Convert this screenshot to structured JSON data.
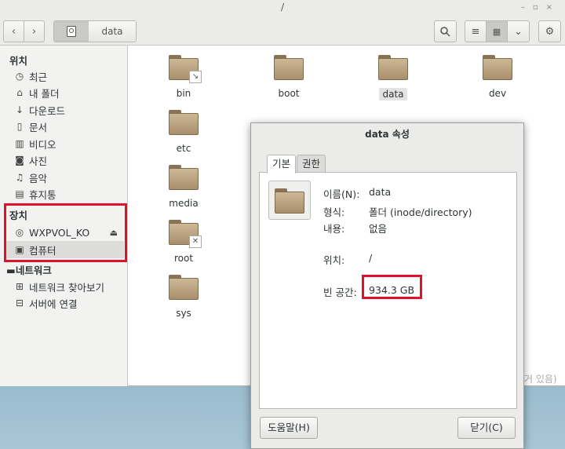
{
  "window": {
    "title": "/",
    "path_current": "data"
  },
  "sidebar": {
    "places_header": "위치",
    "places": [
      {
        "label": "최근",
        "icon": "clock-icon"
      },
      {
        "label": "내 폴더",
        "icon": "home-icon"
      },
      {
        "label": "다운로드",
        "icon": "download-icon"
      },
      {
        "label": "문서",
        "icon": "document-icon"
      },
      {
        "label": "비디오",
        "icon": "video-icon"
      },
      {
        "label": "사진",
        "icon": "camera-icon"
      },
      {
        "label": "음악",
        "icon": "music-icon"
      },
      {
        "label": "휴지통",
        "icon": "trash-icon"
      }
    ],
    "devices_header": "장치",
    "devices": [
      {
        "label": "WXPVOL_KO",
        "icon": "disc-icon"
      },
      {
        "label": "컴퓨터",
        "icon": "computer-icon"
      }
    ],
    "network_header": "네트워크",
    "network": [
      {
        "label": "네트워크 찾아보기",
        "icon": "network-icon"
      },
      {
        "label": "서버에 연결",
        "icon": "server-icon"
      }
    ]
  },
  "files": [
    {
      "name": "bin"
    },
    {
      "name": "boot"
    },
    {
      "name": "data"
    },
    {
      "name": "dev"
    },
    {
      "name": "etc"
    },
    {
      "name": "media"
    },
    {
      "name": "root"
    },
    {
      "name": "sys"
    }
  ],
  "status_fragment": "거 있음)",
  "dialog": {
    "title": "data 속성",
    "tabs": [
      "기본",
      "권한"
    ],
    "name_label": "이름(N):",
    "name_value": "data",
    "type_label": "형식:",
    "type_value": "폴더 (inode/directory)",
    "contents_label": "내용:",
    "contents_value": "없음",
    "location_label": "위치:",
    "location_value": "/",
    "free_label": "빈 공간:",
    "free_value": "934.3 GB",
    "help_button": "도움말(H)",
    "close_button": "닫기(C)"
  },
  "colors": {
    "highlight_box": "#e0112b",
    "folder": "#b9a27f"
  }
}
